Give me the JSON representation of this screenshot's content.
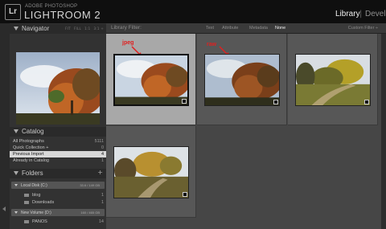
{
  "app": {
    "vendor": "ADOBE PHOTOSHOP",
    "name": "LIGHTROOM 2",
    "logo": "Lr"
  },
  "modules": {
    "library": "Library",
    "separator": "|",
    "develop": "Develo"
  },
  "navigator": {
    "title": "Navigator",
    "zoom_options": [
      "FIT",
      "FILL",
      "1:1",
      "3:1 ÷"
    ]
  },
  "catalog": {
    "title": "Catalog",
    "items": [
      {
        "label": "All Photographs",
        "count": "5111",
        "selected": false
      },
      {
        "label": "Quick Collection +",
        "count": "0",
        "selected": false
      },
      {
        "label": "Previous Import",
        "count": "4",
        "selected": true
      },
      {
        "label": "Already in Catalog",
        "count": "1",
        "selected": false
      }
    ]
  },
  "folders": {
    "title": "Folders",
    "add": "+",
    "volumes": [
      {
        "label": "Local Disk (C:)",
        "space": "33.6 / 149 GB",
        "folders": [
          {
            "label": "blog",
            "count": "1"
          },
          {
            "label": "Downloads",
            "count": "1"
          }
        ]
      },
      {
        "label": "New Volume (D:)",
        "space": "160 / 465 GB",
        "folders": [
          {
            "label": "PANOS",
            "count": "14"
          }
        ]
      }
    ]
  },
  "filter_bar": {
    "title": "Library Filter:",
    "options": [
      "Text",
      "Attribute",
      "Metadata",
      "None"
    ],
    "active": "None",
    "custom": "Custom Filter ÷"
  },
  "grid": {
    "thumbs": [
      {
        "scene": "tree",
        "selected": true,
        "annotation": "jpeg"
      },
      {
        "scene": "tree",
        "selected": false,
        "annotation": "raw"
      },
      {
        "scene": "path",
        "selected": false,
        "annotation": ""
      },
      {
        "scene": "path2",
        "selected": false,
        "annotation": ""
      }
    ]
  },
  "colors": {
    "annotation": "#e02020",
    "selected_cell": "#a8a8a8",
    "cell": "#575757"
  }
}
